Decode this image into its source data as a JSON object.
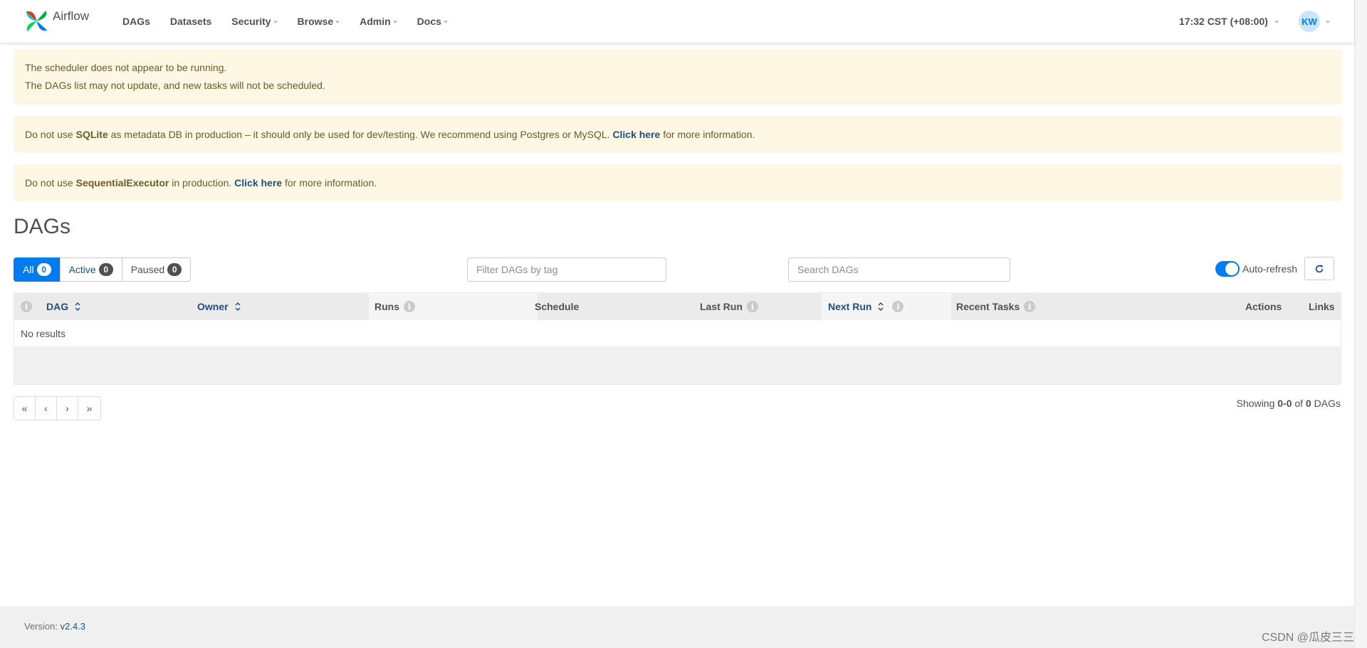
{
  "navbar": {
    "brand": "Airflow",
    "menu": [
      {
        "label": "DAGs",
        "dropdown": false
      },
      {
        "label": "Datasets",
        "dropdown": false
      },
      {
        "label": "Security",
        "dropdown": true
      },
      {
        "label": "Browse",
        "dropdown": true
      },
      {
        "label": "Admin",
        "dropdown": true
      },
      {
        "label": "Docs",
        "dropdown": true
      }
    ],
    "clock": "17:32 CST (+08:00)",
    "user_initials": "KW"
  },
  "alerts": {
    "scheduler": {
      "line1": "The scheduler does not appear to be running.",
      "line2": "The DAGs list may not update, and new tasks will not be scheduled."
    },
    "sqlite": {
      "prefix": "Do not use",
      "strong": "SQLite",
      "middle": "as metadata DB in production – it should only be used for dev/testing. We recommend using Postgres or MySQL.",
      "link": "Click here",
      "suffix": "for more information."
    },
    "executor": {
      "prefix": "Do not use",
      "strong": "SequentialExecutor",
      "middle": "in production.",
      "link": "Click here",
      "suffix": "for more information."
    }
  },
  "page_title": "DAGs",
  "filters": {
    "status": [
      {
        "label": "All",
        "count": "0"
      },
      {
        "label": "Active",
        "count": "0"
      },
      {
        "label": "Paused",
        "count": "0"
      }
    ],
    "tag_placeholder": "Filter DAGs by tag",
    "search_placeholder": "Search DAGs",
    "auto_refresh_label": "Auto-refresh",
    "auto_refresh_on": true
  },
  "table": {
    "columns": {
      "dag": "DAG",
      "owner": "Owner",
      "runs": "Runs",
      "schedule": "Schedule",
      "last_run": "Last Run",
      "next_run": "Next Run",
      "recent_tasks": "Recent Tasks",
      "actions": "Actions",
      "links": "Links"
    },
    "empty_message": "No results"
  },
  "pagination": {
    "first": "«",
    "prev": "‹",
    "next": "›",
    "last": "»",
    "showing_prefix": "Showing",
    "range": "0-0",
    "of": "of",
    "total": "0",
    "suffix": "DAGs"
  },
  "footer": {
    "version_label": "Version:",
    "version": "v2.4.3"
  },
  "watermark": "CSDN @瓜皮三三",
  "colors": {
    "primary": "#017cee",
    "link": "#1c4f82",
    "alert_bg": "#fdf7e3",
    "text": "#51504f"
  }
}
